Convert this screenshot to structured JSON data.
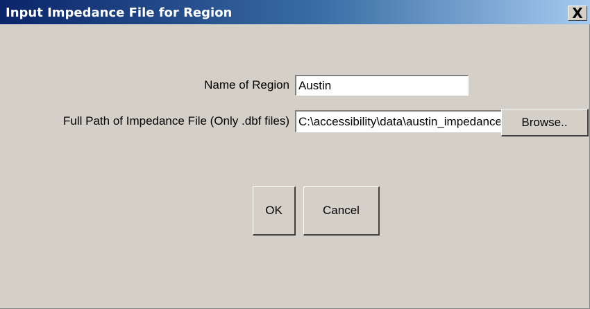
{
  "window": {
    "title": "Input Impedance File for Region",
    "close_glyph": "X"
  },
  "form": {
    "region_label": "Name of Region",
    "region_value": "Austin",
    "path_label": "Full Path of Impedance File (Only .dbf files)",
    "path_value": "C:\\accessibility\\data\\austin_impedance.dbf",
    "browse_label": "Browse.."
  },
  "buttons": {
    "ok_label": "OK",
    "cancel_label": "Cancel"
  },
  "colors": {
    "titlebar_start": "#0a246a",
    "titlebar_end": "#a6caf0",
    "dialog_bg": "#d4d0c8"
  }
}
